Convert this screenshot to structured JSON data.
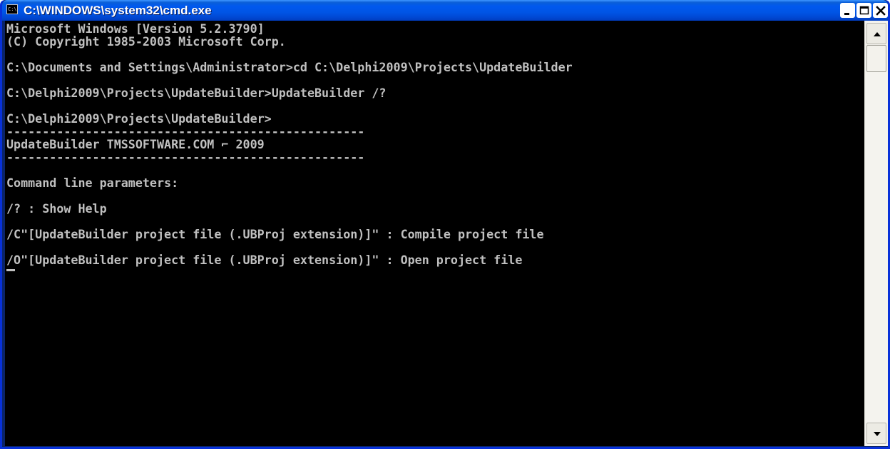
{
  "window": {
    "title": "C:\\WINDOWS\\system32\\cmd.exe",
    "icon_text": "C:\\"
  },
  "console": {
    "lines": [
      "Microsoft Windows [Version 5.2.3790]",
      "(C) Copyright 1985-2003 Microsoft Corp.",
      "",
      "C:\\Documents and Settings\\Administrator>cd C:\\Delphi2009\\Projects\\UpdateBuilder",
      "",
      "C:\\Delphi2009\\Projects\\UpdateBuilder>UpdateBuilder /?",
      "",
      "C:\\Delphi2009\\Projects\\UpdateBuilder>",
      "--------------------------------------------------",
      "UpdateBuilder TMSSOFTWARE.COM ⌐ 2009",
      "--------------------------------------------------",
      "",
      "Command line parameters:",
      "",
      "/? : Show Help",
      "",
      "/C\"[UpdateBuilder project file (.UBProj extension)]\" : Compile project file",
      "",
      "/O\"[UpdateBuilder project file (.UBProj extension)]\" : Open project file"
    ]
  },
  "colors": {
    "title_bar": "#0055e5",
    "console_bg": "#000000",
    "console_fg": "#c0c0c0",
    "close_button": "#e0442c"
  },
  "icons": {
    "minimize": "minimize-icon",
    "maximize": "maximize-icon",
    "close": "close-icon",
    "scroll_up": "arrow-up-icon",
    "scroll_down": "arrow-down-icon"
  }
}
